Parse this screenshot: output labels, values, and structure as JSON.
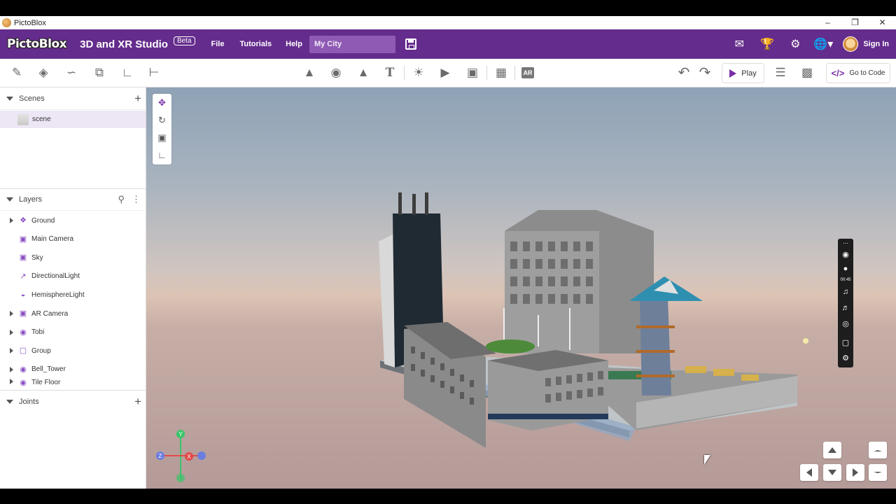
{
  "window": {
    "title": "PictoBlox",
    "controls": [
      "–",
      "❐",
      "✕"
    ]
  },
  "menubar": {
    "logo": "PictoBlox",
    "studio_title": "3D and XR Studio",
    "badge": "Beta",
    "menu": {
      "file": "File",
      "tutorials": "Tutorials",
      "help": "Help"
    },
    "project_name": "My City",
    "sign_in": "Sign In",
    "icons": [
      "feedback-icon",
      "trophy-icon",
      "gear-icon",
      "globe-icon"
    ]
  },
  "toolbar": {
    "left_icons": [
      "pencil-icon",
      "bucket-icon",
      "path-icon",
      "layers-icon",
      "slope-icon",
      "align-icon"
    ],
    "center_icons": [
      "shapes-icon",
      "character-icon",
      "terrain-icon",
      "text-icon",
      "light-icon",
      "camera-icon",
      "image-icon",
      "texture-icon",
      "ar-icon"
    ],
    "ar_label": "AR",
    "text_label": "T",
    "play_label": "Play",
    "code_label": "Go to Code"
  },
  "panels": {
    "scenes_header": "Scenes",
    "scene_name": "scene",
    "layers_header": "Layers",
    "joints_header": "Joints",
    "layers": [
      {
        "label": "Ground",
        "expandable": true,
        "icon": "shape-icon"
      },
      {
        "label": "Main Camera",
        "expandable": false,
        "icon": "cube-icon"
      },
      {
        "label": "Sky",
        "expandable": false,
        "icon": "cube-icon"
      },
      {
        "label": "DirectionalLight",
        "expandable": false,
        "icon": "directional-light-icon"
      },
      {
        "label": "HemisphereLight",
        "expandable": false,
        "icon": "hemisphere-light-icon"
      },
      {
        "label": "AR Camera",
        "expandable": true,
        "icon": "cube-icon"
      },
      {
        "label": "Tobi",
        "expandable": true,
        "icon": "character-icon"
      },
      {
        "label": "Group",
        "expandable": true,
        "icon": "group-icon"
      },
      {
        "label": "Bell_Tower",
        "expandable": true,
        "icon": "character-icon"
      },
      {
        "label": "Tile Floor",
        "expandable": true,
        "icon": "character-icon"
      }
    ]
  },
  "viewport": {
    "axes": {
      "x": "X",
      "y": "Y",
      "z": "Z"
    },
    "recorder_time": "00:45"
  },
  "colors": {
    "brand_purple": "#642c8c",
    "accent_purple": "#7a2ea8",
    "project_field": "#8e5ab4"
  }
}
